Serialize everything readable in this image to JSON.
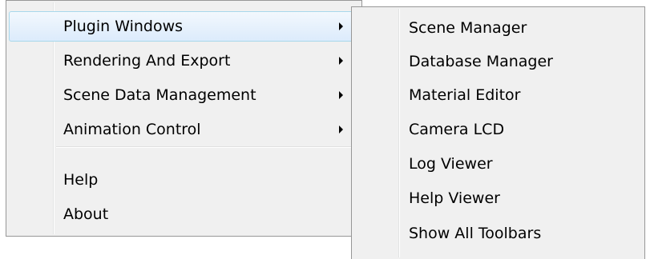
{
  "main_menu": {
    "items": [
      {
        "label": "Plugin Windows",
        "has_submenu": true,
        "highlighted": true
      },
      {
        "label": "Rendering And Export",
        "has_submenu": true
      },
      {
        "label": "Scene Data Management",
        "has_submenu": true
      },
      {
        "label": "Animation Control",
        "has_submenu": true
      },
      {
        "label": "Help",
        "has_submenu": false
      },
      {
        "label": "About",
        "has_submenu": false
      }
    ]
  },
  "submenu": {
    "items": [
      {
        "label": "Scene Manager"
      },
      {
        "label": "Database Manager"
      },
      {
        "label": "Material Editor"
      },
      {
        "label": "Camera LCD"
      },
      {
        "label": "Log Viewer"
      },
      {
        "label": "Help Viewer"
      },
      {
        "label": "Show All Toolbars"
      }
    ]
  },
  "colors": {
    "menu_background": "#f0f0f0",
    "menu_border": "#979797",
    "highlight_border": "#a8d8eb",
    "highlight_fill": "#dcebfc"
  }
}
